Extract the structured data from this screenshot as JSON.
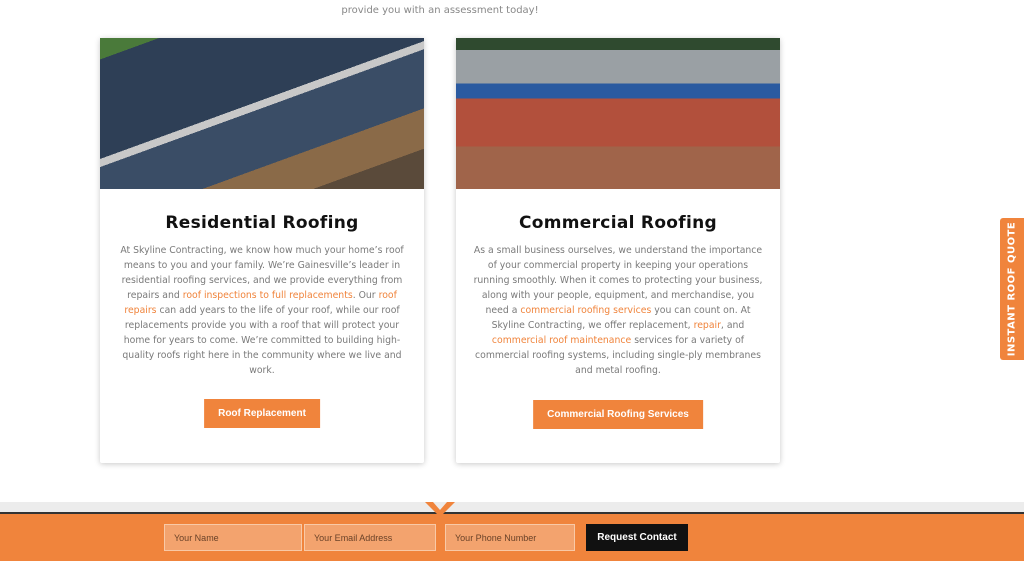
{
  "intro": {
    "text": "provide you with an assessment today!"
  },
  "cards": [
    {
      "title": "Residential Roofing",
      "p1": "At Skyline Contracting, we know how much your home’s roof means to you and your family. We’re Gainesville’s leader in residential roofing services, and we provide everything from repairs and ",
      "l1": "roof inspections to full replacements",
      "p2": ". Our ",
      "l2": "roof repairs",
      "p3": " can add years to the life of your roof, while our roof replacements provide you with a roof that will protect your home for years to come. We’re committed to building high-quality roofs right here in the community where we live and work.",
      "button": "Roof Replacement"
    },
    {
      "title": "Commercial Roofing",
      "p1": "As a small business ourselves, we understand the importance of your commercial property in keeping your operations running smoothly. When it comes to protecting your business, along with your people, equipment, and merchandise, you need a ",
      "l1": "commercial roofing services",
      "p2": " you can count on. At Skyline Contracting, we offer replacement, ",
      "l2": "repair",
      "p3": ", and ",
      "l3": "commercial roof maintenance",
      "p4": " services for a variety of commercial roofing systems, including single-ply membranes and metal roofing.",
      "button": "Commercial Roofing Services"
    }
  ],
  "side_tab": "INSTANT ROOF QUOTE",
  "form": {
    "name_placeholder": "Your Name",
    "email_placeholder": "Your Email Address",
    "phone_placeholder": "Your Phone Number",
    "submit": "Request Contact"
  },
  "colors": {
    "accent": "#f0843c",
    "dark": "#111111"
  }
}
